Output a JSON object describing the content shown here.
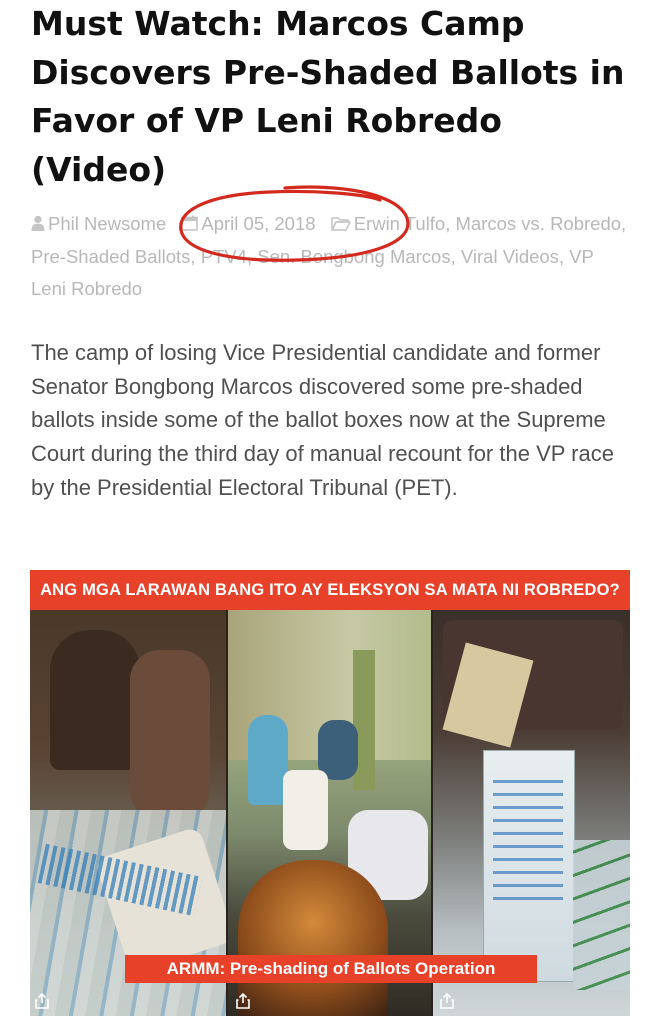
{
  "article": {
    "title": "Must Watch: Marcos Camp Discovers Pre-Shaded Ballots in Favor of VP Leni Robredo (Video)",
    "author": "Phil Newsome",
    "date": "April 05, 2018",
    "tags": [
      "Erwin Tulfo",
      "Marcos vs. Robredo",
      "Pre-Shaded Ballots",
      "PTV4",
      "Sen. Bongbong Marcos",
      "Viral Videos",
      "VP Leni Robredo"
    ],
    "body": "The camp of losing Vice Presidential candidate and former Senator Bongbong Marcos discovered some pre-shaded ballots inside some of the ballot boxes now at the Supreme Court during the third day of manual recount for the VP race by the Presidential Electoral Tribunal (PET)."
  },
  "image": {
    "banner": "ANG MGA LARAWAN BANG ITO AY ELEKSYON SA MATA NI ROBREDO?",
    "caption": "ARMM: Pre-shading of Ballots Operation"
  },
  "icons": {
    "author": "user-icon",
    "date": "calendar-icon",
    "tags": "folder-icon",
    "share": "share-icon"
  },
  "colors": {
    "title": "#111111",
    "meta": "#b8b8b8",
    "body": "#505050",
    "banner": "#e8412a",
    "annotation": "#d42a1e"
  }
}
